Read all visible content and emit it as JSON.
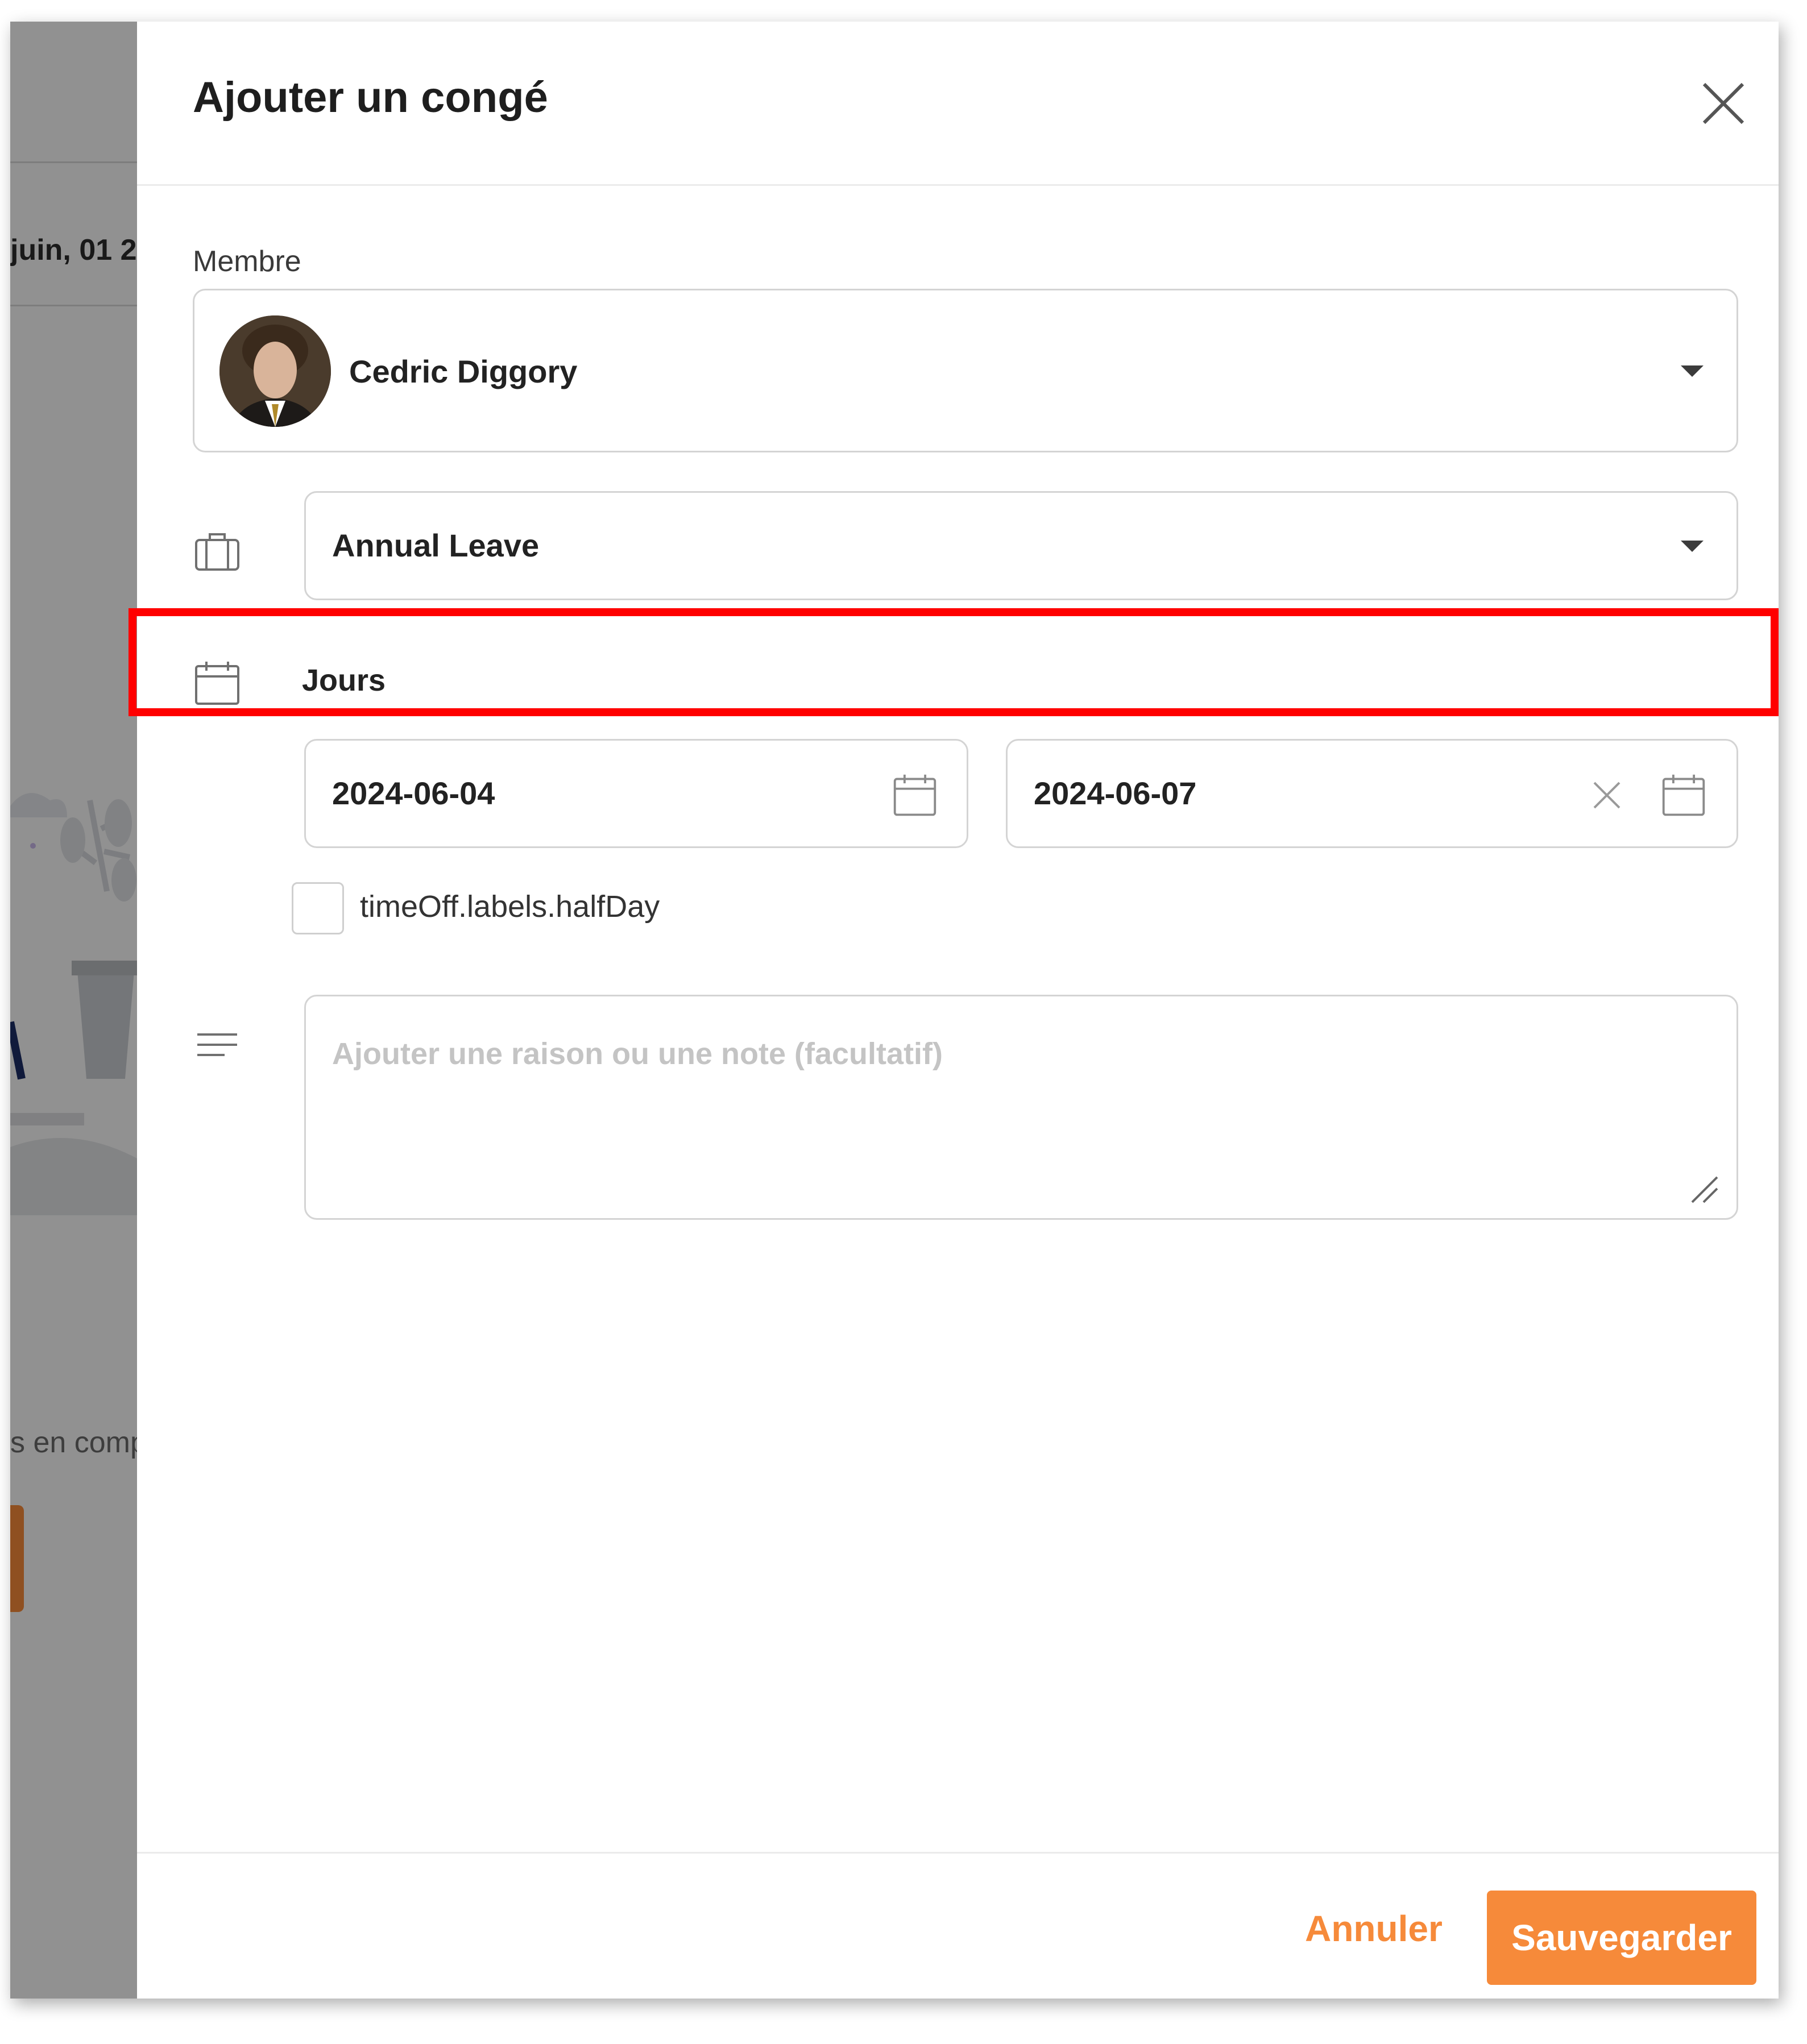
{
  "background": {
    "date_fragment": "juin, 01 2",
    "partial_text": "s en comp"
  },
  "modal": {
    "title": "Ajouter un congé",
    "close_icon": "close-icon"
  },
  "member": {
    "label": "Membre",
    "selected": "Cedric Diggory"
  },
  "leave_type": {
    "selected": "Annual Leave",
    "icon": "briefcase-icon"
  },
  "days": {
    "label": "Jours",
    "icon": "calendar-icon",
    "start_date": "2024-06-04",
    "end_date": "2024-06-07"
  },
  "half_day": {
    "label": "timeOff.labels.halfDay",
    "checked": false
  },
  "note": {
    "placeholder": "Ajouter une raison ou une note (facultatif)",
    "icon": "text-lines-icon"
  },
  "footer": {
    "cancel_label": "Annuler",
    "save_label": "Sauvegarder"
  },
  "colors": {
    "accent": "#f68a3a",
    "highlight": "#ff0000",
    "border": "#d4d4d4"
  }
}
